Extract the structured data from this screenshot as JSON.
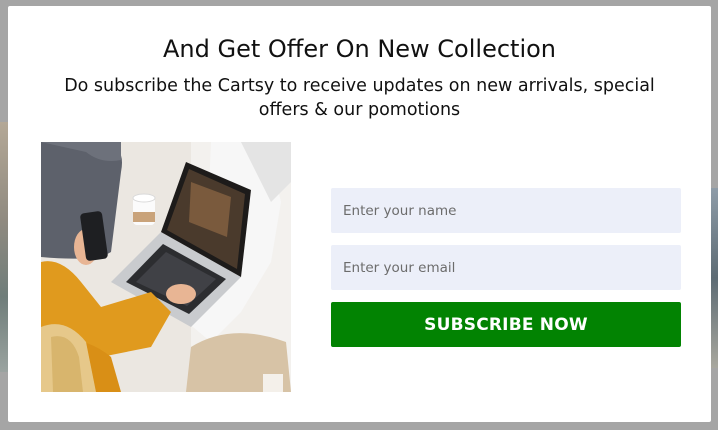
{
  "modal": {
    "title": "And Get Offer On New Collection",
    "subtitle": "Do subscribe the Cartsy to receive updates on new arrivals, special offers & our pomotions"
  },
  "photo": {
    "description_icon": "woman-with-laptop-photo"
  },
  "form": {
    "name_placeholder": "Enter your name",
    "email_placeholder": "Enter your email",
    "subscribe_label": "SUBSCRIBE NOW"
  },
  "colors": {
    "button": "#028302",
    "field_bg": "#eceff9",
    "overlay": "#a5a5a5"
  }
}
